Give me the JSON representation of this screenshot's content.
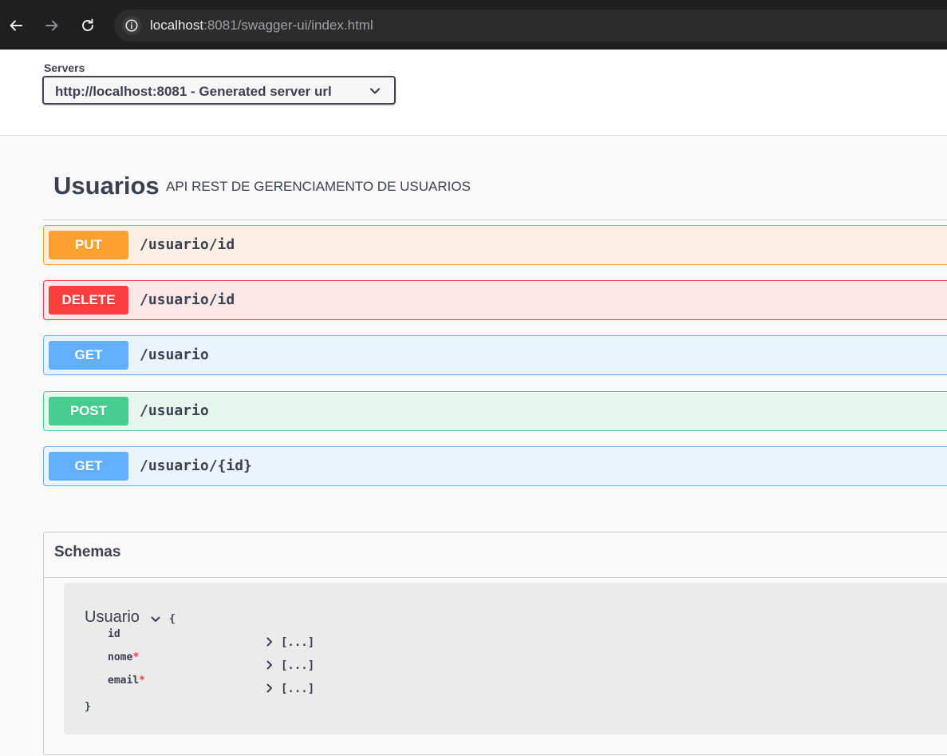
{
  "browser": {
    "url_host": "localhost",
    "url_rest": ":8081/swagger-ui/index.html"
  },
  "servers": {
    "label": "Servers",
    "selected": "http://localhost:8081 - Generated server url"
  },
  "tag": {
    "name": "Usuarios",
    "description": "API REST DE GERENCIAMENTO DE USUARIOS"
  },
  "operations": [
    {
      "method": "PUT",
      "path": "/usuario/id"
    },
    {
      "method": "DELETE",
      "path": "/usuario/id"
    },
    {
      "method": "GET",
      "path": "/usuario"
    },
    {
      "method": "POST",
      "path": "/usuario"
    },
    {
      "method": "GET",
      "path": "/usuario/{id}"
    }
  ],
  "schemas": {
    "title": "Schemas",
    "model": {
      "name": "Usuario",
      "open_brace": "{",
      "close_brace": "}",
      "properties": [
        {
          "name": "id",
          "required": "",
          "value": "[...]"
        },
        {
          "name": "nome",
          "required": "*",
          "value": "[...]"
        },
        {
          "name": "email",
          "required": "*",
          "value": "[...]"
        }
      ]
    }
  },
  "colors": {
    "put": "#fca130",
    "delete": "#f93e3e",
    "get": "#61affe",
    "post": "#49cc90"
  }
}
